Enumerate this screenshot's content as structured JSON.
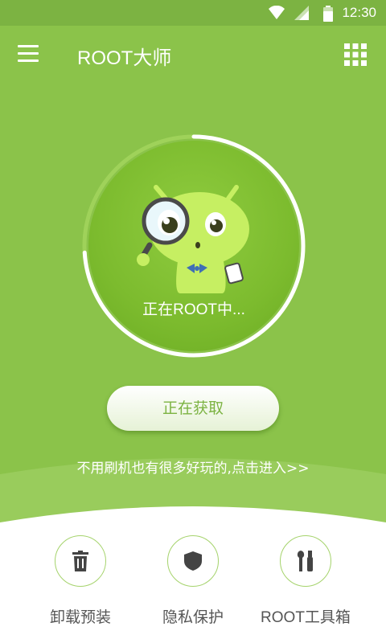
{
  "status_bar": {
    "time": "12:30"
  },
  "app_bar": {
    "title": "ROOT大师"
  },
  "progress": {
    "fraction": 0.74,
    "text": "正在ROOT中..."
  },
  "action_button": {
    "label": "正在获取"
  },
  "promo_link": "不用刷机也有很多好玩的,点击进入>>",
  "tools": [
    {
      "label": "卸载预装",
      "icon": "trash-icon"
    },
    {
      "label": "隐私保护",
      "icon": "shield-icon"
    },
    {
      "label": "ROOT工具箱",
      "icon": "tools-icon"
    }
  ],
  "colors": {
    "primary": "#8bc34a",
    "status_bar": "#7cb342",
    "tool_border": "#a5d36c"
  }
}
